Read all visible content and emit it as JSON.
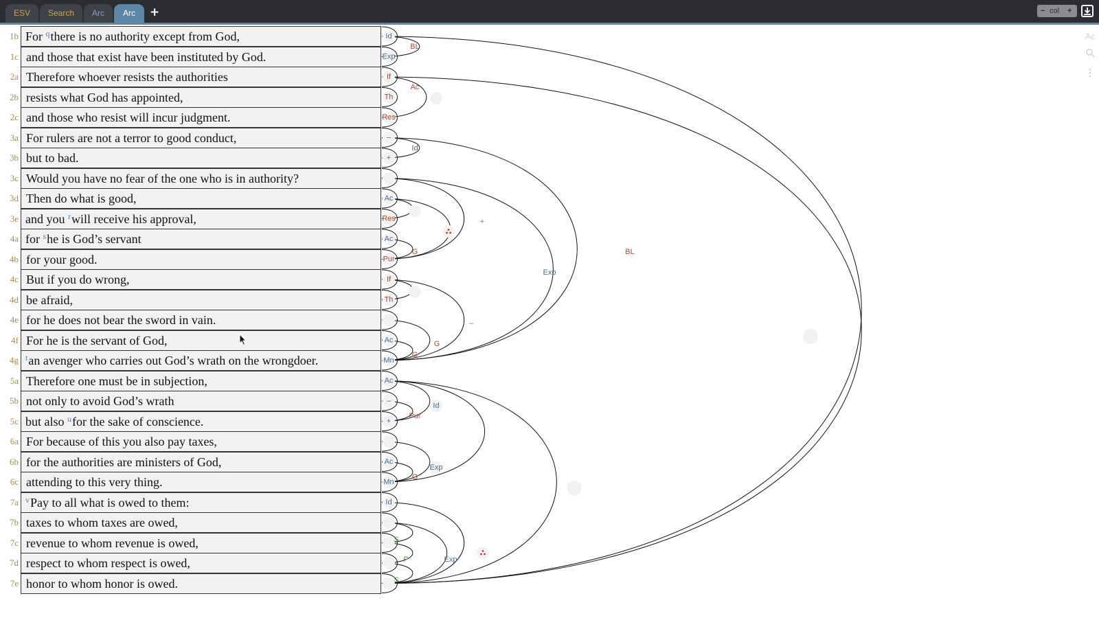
{
  "tabs": [
    {
      "label": "ESV",
      "active": false
    },
    {
      "label": "Search",
      "active": false
    },
    {
      "label": "Arc",
      "active": false
    },
    {
      "label": "Arc",
      "active": true
    }
  ],
  "tab_add_label": "+",
  "col_control": {
    "minus": "−",
    "label": "col",
    "plus": "+"
  },
  "right_tools": {
    "font_label": "Ac"
  },
  "colors": {
    "accent": "#5d86a6",
    "topbar": "#2b2d31",
    "label_red": "#b5442e",
    "label_blue": "#4d6a8c",
    "verse_num": "#b08a4a"
  },
  "verses": [
    {
      "num": "1b",
      "fn": "q",
      "text": "there is no authority except from God,",
      "pre": "For "
    },
    {
      "num": "1c",
      "fn": "",
      "text": "and those that exist have been instituted by God.",
      "pre": ""
    },
    {
      "num": "2a",
      "fn": "",
      "text": "Therefore whoever resists the authorities",
      "pre": ""
    },
    {
      "num": "2b",
      "fn": "",
      "text": "resists what God has appointed,",
      "pre": ""
    },
    {
      "num": "2c",
      "fn": "",
      "text": "and those who resist will incur judgment.",
      "pre": ""
    },
    {
      "num": "3a",
      "fn": "",
      "text": "For rulers are not a terror to good conduct,",
      "pre": ""
    },
    {
      "num": "3b",
      "fn": "",
      "text": "but to bad.",
      "pre": ""
    },
    {
      "num": "3c",
      "fn": "",
      "text": "Would you have no fear of the one who is in authority?",
      "pre": ""
    },
    {
      "num": "3d",
      "fn": "",
      "text": "Then do what is good,",
      "pre": ""
    },
    {
      "num": "3e",
      "fn": "r",
      "text": "will receive his approval,",
      "pre": "and you "
    },
    {
      "num": "4a",
      "fn": "s",
      "text": "he is God’s servant",
      "pre": "for "
    },
    {
      "num": "4b",
      "fn": "",
      "text": "for your good.",
      "pre": ""
    },
    {
      "num": "4c",
      "fn": "",
      "text": "But if you do wrong,",
      "pre": ""
    },
    {
      "num": "4d",
      "fn": "",
      "text": "be afraid,",
      "pre": ""
    },
    {
      "num": "4e",
      "fn": "",
      "text": "for he does not bear the sword in vain.",
      "pre": ""
    },
    {
      "num": "4f",
      "fn": "",
      "text": "For he is the servant of God,",
      "pre": ""
    },
    {
      "num": "4g",
      "fn": "t",
      "text": "an avenger who carries out God’s wrath on the wrongdoer.",
      "pre": ""
    },
    {
      "num": "5a",
      "fn": "",
      "text": "Therefore one must be in subjection,",
      "pre": ""
    },
    {
      "num": "5b",
      "fn": "",
      "text": "not only to avoid God’s wrath",
      "pre": ""
    },
    {
      "num": "5c",
      "fn": "u",
      "text": "for the sake of conscience.",
      "pre": "but also "
    },
    {
      "num": "6a",
      "fn": "",
      "text": "For because of this you also pay taxes,",
      "pre": ""
    },
    {
      "num": "6b",
      "fn": "",
      "text": "for the authorities are ministers of God,",
      "pre": ""
    },
    {
      "num": "6c",
      "fn": "",
      "text": "attending to this very thing.",
      "pre": ""
    },
    {
      "num": "7a",
      "fn": "v",
      "text": "Pay to all what is owed to them:",
      "pre": ""
    },
    {
      "num": "7b",
      "fn": "",
      "text": "taxes to whom taxes are owed,",
      "pre": ""
    },
    {
      "num": "7c",
      "fn": "",
      "text": "revenue to whom revenue is owed,",
      "pre": ""
    },
    {
      "num": "7d",
      "fn": "",
      "text": "respect to whom respect is owed,",
      "pre": ""
    },
    {
      "num": "7e",
      "fn": "",
      "text": "honor to whom honor is owed.",
      "pre": ""
    }
  ],
  "leaf_labels": [
    "Id",
    "Exp",
    "If",
    "Th",
    "Res",
    "–",
    "+",
    "",
    "Ac",
    "Res",
    "Ac",
    "Pur",
    "If",
    "Th",
    "",
    "Ac",
    "Mn",
    "Ac",
    "–",
    "+",
    "",
    "Ac",
    "Mn",
    "Id",
    "",
    "",
    "",
    ""
  ],
  "arc_labels": {
    "l1": "BL",
    "l2": "Ac",
    "l3": "Id",
    "g1": "G",
    "plus": "+",
    "dash": "–",
    "g2": "G",
    "g3": "G",
    "pur": "Pur",
    "id2": "Id",
    "g4": "G",
    "exp2": "Exp",
    "s1": "S",
    "p1": "P",
    "s2": "S",
    "exp3": "Exp",
    "exp1": "Exp",
    "bl2": "BL"
  }
}
